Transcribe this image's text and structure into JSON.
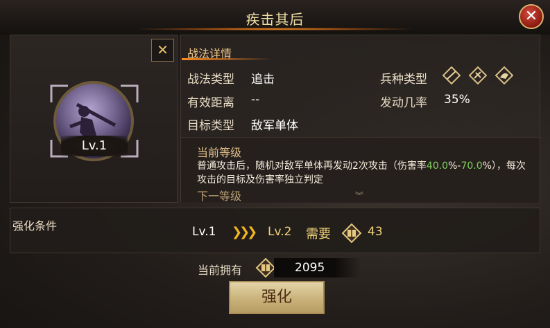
{
  "header": {
    "title": "疾击其后",
    "close_icon": "close-icon"
  },
  "skill": {
    "level": "Lv.1"
  },
  "details": {
    "section_title": "战法详情",
    "type_label": "战法类型",
    "type_value": "追击",
    "range_label": "有效距离",
    "range_value": "--",
    "target_label": "目标类型",
    "target_value": "敌军单体",
    "troop_label": "兵种类型",
    "troop_icons": [
      "troop-type-1-icon",
      "troop-type-2-icon",
      "troop-type-3-icon"
    ],
    "rate_label": "发动几率",
    "rate_value": "35%"
  },
  "description": {
    "current_label": "当前等级",
    "text_part1": "普通攻击后，随机对敌军单体再发动2次攻击（伤害率",
    "rate_low": "40.0",
    "text_part2": "%-",
    "rate_high": "70.0",
    "text_part3": "%），每次攻击的目标及伤害率独立判定",
    "next_label": "下一等级"
  },
  "upgrade": {
    "title": "强化条件",
    "from_level": "Lv.1",
    "arrows": "》》》",
    "to_level": "Lv.2",
    "need_label": "需要",
    "need_value": "43",
    "own_label": "当前拥有",
    "own_value": "2095",
    "button_label": "强化"
  },
  "colors": {
    "accent": "#f0c98a",
    "highlight_green": "#7ccf5a",
    "gold": "#f0b51f"
  }
}
